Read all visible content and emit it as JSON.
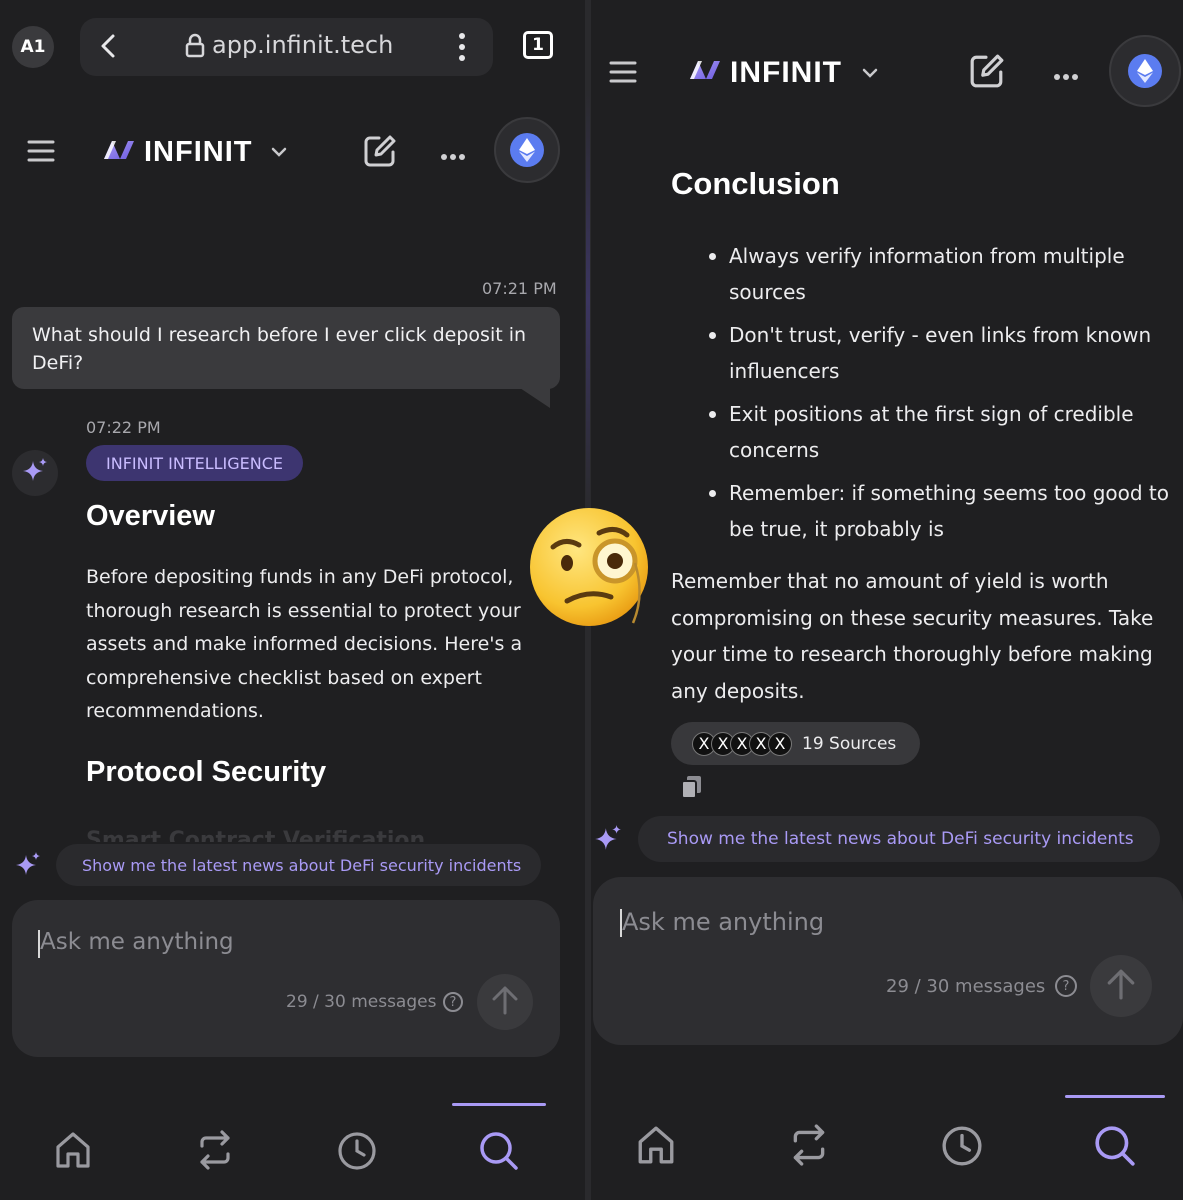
{
  "browser": {
    "tab_avatar": "A1",
    "url": "app.infinit.tech",
    "tab_count": "1"
  },
  "header": {
    "brand": "INFINIT"
  },
  "left_panel": {
    "user_time": "07:21 PM",
    "user_message": "What should I research before I ever click deposit in DeFi?",
    "ai_time": "07:22 PM",
    "ai_badge": "INFINIT INTELLIGENCE",
    "heading_overview": "Overview",
    "overview_text": "Before depositing funds in any DeFi protocol, thorough research is essential to protect your assets and make informed decisions. Here's a comprehensive checklist based on expert recommendations.",
    "heading_security": "Protocol Security",
    "faded_subheading": "Smart Contract Verification",
    "suggestion": "Show me the latest news about DeFi security incidents",
    "input_placeholder": "Ask me anything",
    "message_counter": "29 / 30 messages"
  },
  "right_panel": {
    "heading_conclusion": "Conclusion",
    "bullets": [
      "Always verify information from multiple sources",
      "Don't trust, verify - even links from known influencers",
      "Exit positions at the first sign of credible concerns",
      "Remember: if something seems too good to be true, it probably is"
    ],
    "closing_text": "Remember that no amount of yield is worth compromising on these security measures. Take your time to research thoroughly before making any deposits.",
    "sources_label": "19 Sources",
    "source_avatar_glyph": "X",
    "suggestion": "Show me the latest news about DeFi security incidents",
    "input_placeholder": "Ask me anything",
    "message_counter": "29 / 30 messages"
  },
  "nav": {
    "items": [
      "home-icon",
      "swap-icon",
      "history-icon",
      "search-icon"
    ],
    "active": "search-icon"
  },
  "colors": {
    "accent": "#a99af5",
    "badge_bg": "#3d3570",
    "eth_blue": "#5b7cf0",
    "panel_bg": "#1f1f21"
  },
  "sticker": "face-with-monocle-emoji"
}
